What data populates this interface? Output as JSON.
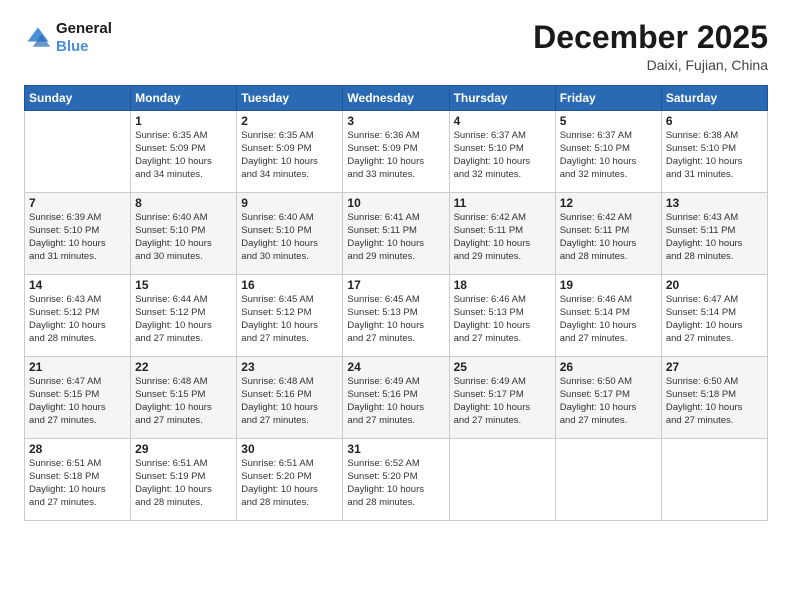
{
  "logo": {
    "line1": "General",
    "line2": "Blue"
  },
  "calendar": {
    "title": "December 2025",
    "subtitle": "Daixi, Fujian, China"
  },
  "headers": [
    "Sunday",
    "Monday",
    "Tuesday",
    "Wednesday",
    "Thursday",
    "Friday",
    "Saturday"
  ],
  "weeks": [
    [
      {
        "day": "",
        "lines": []
      },
      {
        "day": "1",
        "lines": [
          "Sunrise: 6:35 AM",
          "Sunset: 5:09 PM",
          "Daylight: 10 hours",
          "and 34 minutes."
        ]
      },
      {
        "day": "2",
        "lines": [
          "Sunrise: 6:35 AM",
          "Sunset: 5:09 PM",
          "Daylight: 10 hours",
          "and 34 minutes."
        ]
      },
      {
        "day": "3",
        "lines": [
          "Sunrise: 6:36 AM",
          "Sunset: 5:09 PM",
          "Daylight: 10 hours",
          "and 33 minutes."
        ]
      },
      {
        "day": "4",
        "lines": [
          "Sunrise: 6:37 AM",
          "Sunset: 5:10 PM",
          "Daylight: 10 hours",
          "and 32 minutes."
        ]
      },
      {
        "day": "5",
        "lines": [
          "Sunrise: 6:37 AM",
          "Sunset: 5:10 PM",
          "Daylight: 10 hours",
          "and 32 minutes."
        ]
      },
      {
        "day": "6",
        "lines": [
          "Sunrise: 6:38 AM",
          "Sunset: 5:10 PM",
          "Daylight: 10 hours",
          "and 31 minutes."
        ]
      }
    ],
    [
      {
        "day": "7",
        "lines": [
          "Sunrise: 6:39 AM",
          "Sunset: 5:10 PM",
          "Daylight: 10 hours",
          "and 31 minutes."
        ]
      },
      {
        "day": "8",
        "lines": [
          "Sunrise: 6:40 AM",
          "Sunset: 5:10 PM",
          "Daylight: 10 hours",
          "and 30 minutes."
        ]
      },
      {
        "day": "9",
        "lines": [
          "Sunrise: 6:40 AM",
          "Sunset: 5:10 PM",
          "Daylight: 10 hours",
          "and 30 minutes."
        ]
      },
      {
        "day": "10",
        "lines": [
          "Sunrise: 6:41 AM",
          "Sunset: 5:11 PM",
          "Daylight: 10 hours",
          "and 29 minutes."
        ]
      },
      {
        "day": "11",
        "lines": [
          "Sunrise: 6:42 AM",
          "Sunset: 5:11 PM",
          "Daylight: 10 hours",
          "and 29 minutes."
        ]
      },
      {
        "day": "12",
        "lines": [
          "Sunrise: 6:42 AM",
          "Sunset: 5:11 PM",
          "Daylight: 10 hours",
          "and 28 minutes."
        ]
      },
      {
        "day": "13",
        "lines": [
          "Sunrise: 6:43 AM",
          "Sunset: 5:11 PM",
          "Daylight: 10 hours",
          "and 28 minutes."
        ]
      }
    ],
    [
      {
        "day": "14",
        "lines": [
          "Sunrise: 6:43 AM",
          "Sunset: 5:12 PM",
          "Daylight: 10 hours",
          "and 28 minutes."
        ]
      },
      {
        "day": "15",
        "lines": [
          "Sunrise: 6:44 AM",
          "Sunset: 5:12 PM",
          "Daylight: 10 hours",
          "and 27 minutes."
        ]
      },
      {
        "day": "16",
        "lines": [
          "Sunrise: 6:45 AM",
          "Sunset: 5:12 PM",
          "Daylight: 10 hours",
          "and 27 minutes."
        ]
      },
      {
        "day": "17",
        "lines": [
          "Sunrise: 6:45 AM",
          "Sunset: 5:13 PM",
          "Daylight: 10 hours",
          "and 27 minutes."
        ]
      },
      {
        "day": "18",
        "lines": [
          "Sunrise: 6:46 AM",
          "Sunset: 5:13 PM",
          "Daylight: 10 hours",
          "and 27 minutes."
        ]
      },
      {
        "day": "19",
        "lines": [
          "Sunrise: 6:46 AM",
          "Sunset: 5:14 PM",
          "Daylight: 10 hours",
          "and 27 minutes."
        ]
      },
      {
        "day": "20",
        "lines": [
          "Sunrise: 6:47 AM",
          "Sunset: 5:14 PM",
          "Daylight: 10 hours",
          "and 27 minutes."
        ]
      }
    ],
    [
      {
        "day": "21",
        "lines": [
          "Sunrise: 6:47 AM",
          "Sunset: 5:15 PM",
          "Daylight: 10 hours",
          "and 27 minutes."
        ]
      },
      {
        "day": "22",
        "lines": [
          "Sunrise: 6:48 AM",
          "Sunset: 5:15 PM",
          "Daylight: 10 hours",
          "and 27 minutes."
        ]
      },
      {
        "day": "23",
        "lines": [
          "Sunrise: 6:48 AM",
          "Sunset: 5:16 PM",
          "Daylight: 10 hours",
          "and 27 minutes."
        ]
      },
      {
        "day": "24",
        "lines": [
          "Sunrise: 6:49 AM",
          "Sunset: 5:16 PM",
          "Daylight: 10 hours",
          "and 27 minutes."
        ]
      },
      {
        "day": "25",
        "lines": [
          "Sunrise: 6:49 AM",
          "Sunset: 5:17 PM",
          "Daylight: 10 hours",
          "and 27 minutes."
        ]
      },
      {
        "day": "26",
        "lines": [
          "Sunrise: 6:50 AM",
          "Sunset: 5:17 PM",
          "Daylight: 10 hours",
          "and 27 minutes."
        ]
      },
      {
        "day": "27",
        "lines": [
          "Sunrise: 6:50 AM",
          "Sunset: 5:18 PM",
          "Daylight: 10 hours",
          "and 27 minutes."
        ]
      }
    ],
    [
      {
        "day": "28",
        "lines": [
          "Sunrise: 6:51 AM",
          "Sunset: 5:18 PM",
          "Daylight: 10 hours",
          "and 27 minutes."
        ]
      },
      {
        "day": "29",
        "lines": [
          "Sunrise: 6:51 AM",
          "Sunset: 5:19 PM",
          "Daylight: 10 hours",
          "and 28 minutes."
        ]
      },
      {
        "day": "30",
        "lines": [
          "Sunrise: 6:51 AM",
          "Sunset: 5:20 PM",
          "Daylight: 10 hours",
          "and 28 minutes."
        ]
      },
      {
        "day": "31",
        "lines": [
          "Sunrise: 6:52 AM",
          "Sunset: 5:20 PM",
          "Daylight: 10 hours",
          "and 28 minutes."
        ]
      },
      {
        "day": "",
        "lines": []
      },
      {
        "day": "",
        "lines": []
      },
      {
        "day": "",
        "lines": []
      }
    ]
  ]
}
